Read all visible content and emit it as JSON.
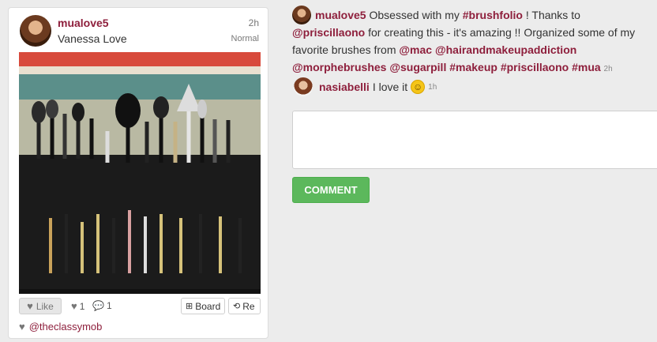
{
  "post": {
    "username": "mualove5",
    "display_name": "Vanessa Love",
    "time": "2h",
    "filter": "Normal",
    "like_label": "Like",
    "like_count": "1",
    "comment_count": "1",
    "board_label": "Board",
    "repost_label": "Re",
    "liked_by": "@theclassymob"
  },
  "caption": {
    "username": "mualove5",
    "text_1": " Obsessed with my ",
    "tag_1": "#brushfolio",
    "text_2": " ! Thanks to ",
    "mention_1": "@priscillaono",
    "text_3": " for creating this - it's amazing !! Organized some of my favorite brushes from ",
    "mention_2": "@mac",
    "mention_3": "@hairandmakeupaddiction",
    "mention_4": "@morphebrushes",
    "mention_5": "@sugarpill",
    "tag_2": "#makeup",
    "tag_3": "#priscillaono",
    "tag_4": "#mua",
    "time": "2h"
  },
  "comment": {
    "username": "nasiabelli",
    "text": "I love it",
    "emoji": "☺",
    "time": "1h"
  },
  "form": {
    "placeholder": "",
    "button_label": "COMMENT"
  },
  "colors": {
    "accent": "#8e1f3c",
    "button": "#5cb85c",
    "background": "#ececec"
  },
  "icons": {
    "like": "heart-icon",
    "comments": "speech-bubble-icon",
    "board": "plus-square-icon",
    "repost": "retweet-icon"
  }
}
